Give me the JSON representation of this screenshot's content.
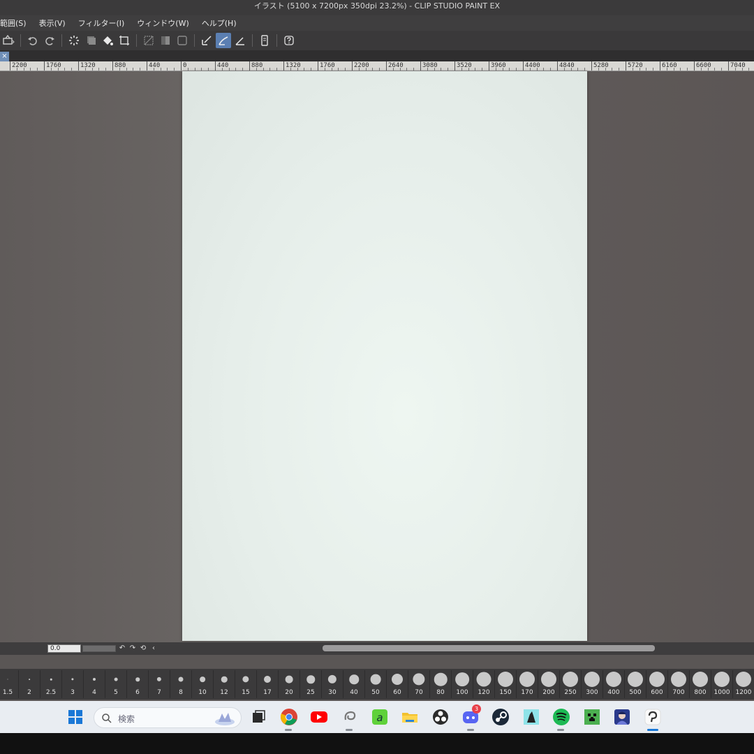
{
  "window": {
    "title": "イラスト (5100 x 7200px 350dpi 23.2%)  - CLIP STUDIO PAINT EX"
  },
  "menu": [
    {
      "label": "範囲(S)"
    },
    {
      "label": "表示(V)"
    },
    {
      "label": "フィルター(I)"
    },
    {
      "label": "ウィンドウ(W)"
    },
    {
      "label": "ヘルプ(H)"
    }
  ],
  "toolbar_icons": [
    "save-icon",
    "undo-icon",
    "redo-icon",
    "loading-icon",
    "layer-icon",
    "fill-icon",
    "crop-icon",
    "deselect-icon",
    "invert-icon",
    "mask-icon",
    "ruler-snap-icon",
    "pen-correction-icon",
    "vector-icon",
    "device-icon",
    "help-icon"
  ],
  "ruler": {
    "labels": [
      "2200",
      "1760",
      "1320",
      "880",
      "440",
      "0",
      "440",
      "880",
      "1320",
      "1760",
      "2200",
      "2640",
      "3080",
      "3520",
      "3960",
      "4400",
      "4840",
      "5280",
      "5720",
      "6160",
      "6600",
      "7040"
    ]
  },
  "navigator": {
    "zoom_value": "0.0",
    "rotate_left": "↶",
    "rotate_right": "↷",
    "reset": "⟲",
    "flip": "‹"
  },
  "brush_sizes": [
    "1.5",
    "2",
    "2.5",
    "3",
    "4",
    "5",
    "6",
    "7",
    "8",
    "10",
    "12",
    "15",
    "17",
    "20",
    "25",
    "30",
    "40",
    "50",
    "60",
    "70",
    "80",
    "100",
    "120",
    "150",
    "170",
    "200",
    "250",
    "300",
    "400",
    "500",
    "600",
    "700",
    "800",
    "1000",
    "1200"
  ],
  "taskbar": {
    "search_placeholder": "検索",
    "discord_badge": "3"
  }
}
